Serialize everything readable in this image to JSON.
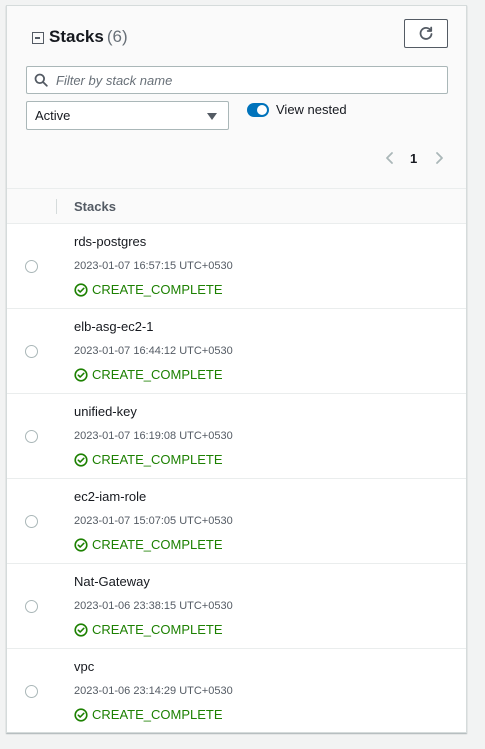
{
  "panel": {
    "title": "Stacks",
    "count": "(6)",
    "search": {
      "placeholder": "Filter by stack name",
      "value": ""
    },
    "filter_select": {
      "selected": "Active"
    },
    "view_nested": {
      "label": "View nested",
      "checked": true
    },
    "pagination": {
      "current_page": "1"
    },
    "table": {
      "column_header": "Stacks",
      "rows": [
        {
          "name": "rds-postgres",
          "timestamp": "2023-01-07 16:57:15 UTC+0530",
          "status": "CREATE_COMPLETE"
        },
        {
          "name": "elb-asg-ec2-1",
          "timestamp": "2023-01-07 16:44:12 UTC+0530",
          "status": "CREATE_COMPLETE"
        },
        {
          "name": "unified-key",
          "timestamp": "2023-01-07 16:19:08 UTC+0530",
          "status": "CREATE_COMPLETE"
        },
        {
          "name": "ec2-iam-role",
          "timestamp": "2023-01-07 15:07:05 UTC+0530",
          "status": "CREATE_COMPLETE"
        },
        {
          "name": "Nat-Gateway",
          "timestamp": "2023-01-06 23:38:15 UTC+0530",
          "status": "CREATE_COMPLETE"
        },
        {
          "name": "vpc",
          "timestamp": "2023-01-06 23:14:29 UTC+0530",
          "status": "CREATE_COMPLETE"
        }
      ]
    }
  },
  "icons": {
    "collapse": "collapse-square-icon",
    "refresh": "refresh-icon",
    "search": "search-icon",
    "caret": "caret-down-icon",
    "prev": "chevron-left-icon",
    "next": "chevron-right-icon",
    "status": "check-circle-icon"
  },
  "colors": {
    "accent": "#0073bb",
    "success": "#1d8102",
    "page_background": "#f2f3f3"
  }
}
